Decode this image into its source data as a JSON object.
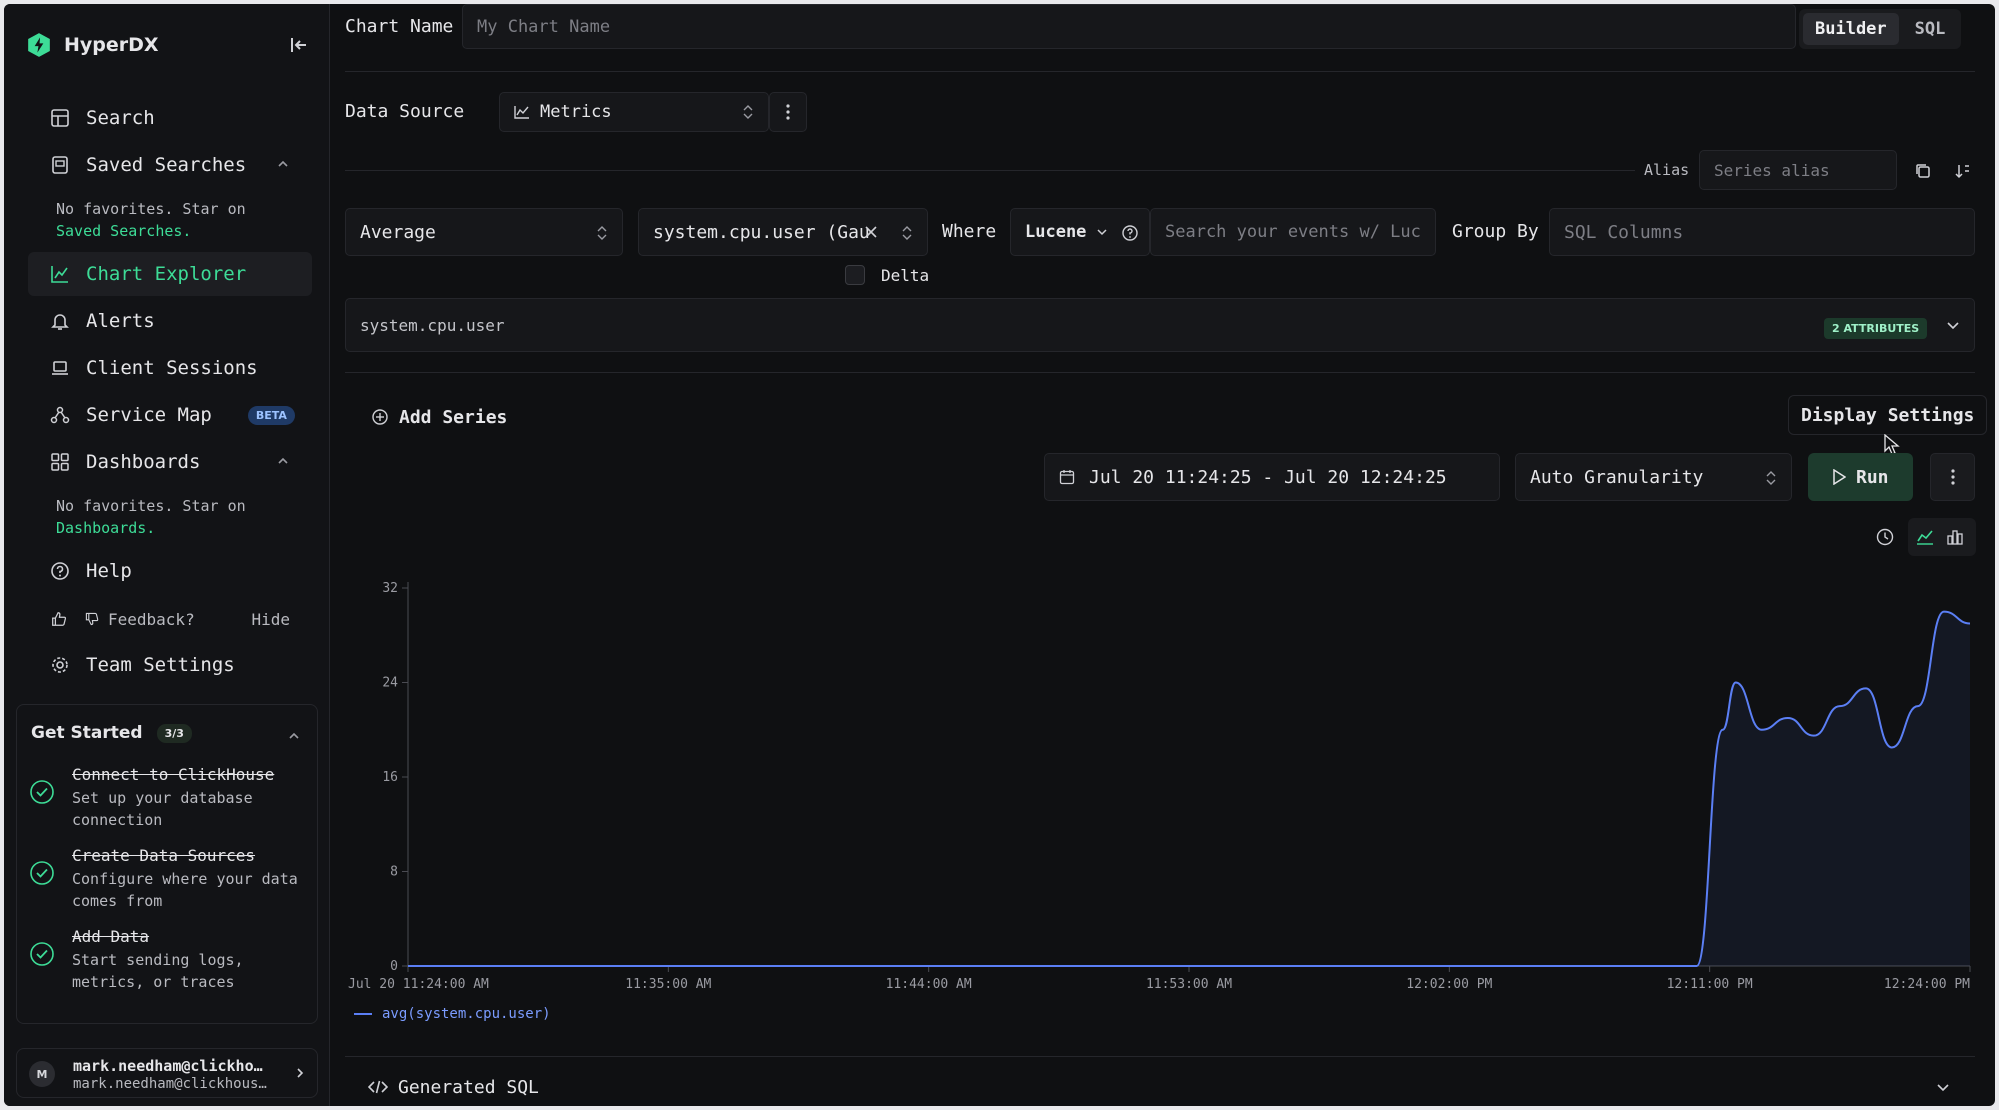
{
  "app": {
    "name": "HyperDX"
  },
  "sidebar": {
    "items": [
      {
        "label": "Search"
      },
      {
        "label": "Saved Searches"
      },
      {
        "label": "Chart Explorer"
      },
      {
        "label": "Alerts"
      },
      {
        "label": "Client Sessions"
      },
      {
        "label": "Service Map",
        "badge": "BETA"
      },
      {
        "label": "Dashboards"
      },
      {
        "label": "Help"
      },
      {
        "label": "Team Settings"
      }
    ],
    "saved_searches_note": "No favorites. Star on",
    "saved_searches_link": "Saved Searches.",
    "dashboards_note": "No favorites. Star on",
    "dashboards_link": "Dashboards.",
    "feedback_label": "Feedback?",
    "hide_label": "Hide",
    "get_started": {
      "title": "Get Started",
      "count": "3/3",
      "tasks": [
        {
          "title": "Connect to ClickHouse",
          "desc": "Set up your database connection"
        },
        {
          "title": "Create Data Sources",
          "desc": "Configure where your data comes from"
        },
        {
          "title": "Add Data",
          "desc": "Start sending logs, metrics, or traces"
        }
      ]
    },
    "user": {
      "initial": "M",
      "name": "mark.needham@clickho…",
      "email": "mark.needham@clickhous…"
    }
  },
  "header": {
    "chart_name_label": "Chart Name",
    "chart_name_placeholder": "My Chart Name",
    "mode_builder": "Builder",
    "mode_sql": "SQL"
  },
  "source": {
    "label": "Data Source",
    "value": "Metrics"
  },
  "series": {
    "alias_label": "Alias",
    "alias_placeholder": "Series alias",
    "aggregation": "Average",
    "metric": "system.cpu.user (Gau",
    "where_label": "Where",
    "query_language": "Lucene",
    "search_placeholder": "Search your events w/ Luc",
    "group_by_label": "Group By",
    "group_by_placeholder": "SQL Columns",
    "delta_label": "Delta",
    "metric_name": "system.cpu.user",
    "attributes_badge": "2 ATTRIBUTES"
  },
  "actions": {
    "add_series": "Add Series",
    "display_settings": "Display Settings",
    "time_range": "Jul 20 11:24:25 - Jul 20 12:24:25",
    "granularity": "Auto Granularity",
    "run": "Run"
  },
  "chart_data": {
    "type": "line",
    "x_tick_labels": [
      "Jul 20 11:24:00 AM",
      "11:35:00 AM",
      "11:44:00 AM",
      "11:53:00 AM",
      "12:02:00 PM",
      "12:11:00 PM",
      "12:24:00 PM"
    ],
    "y_ticks": [
      0,
      8,
      16,
      24,
      32
    ],
    "ylim": [
      0,
      32
    ],
    "series": [
      {
        "name": "avg(system.cpu.user)",
        "color": "#5b7ff5",
        "x_minutes": [
          0,
          5,
          10,
          15,
          20,
          25,
          30,
          35,
          40,
          45,
          49.5,
          50.5,
          51,
          52,
          53,
          54,
          55,
          56,
          57,
          58,
          59,
          60
        ],
        "values": [
          0,
          0,
          0,
          0,
          0,
          0,
          0,
          0,
          0,
          0,
          0,
          20,
          24,
          20,
          21,
          19.5,
          22,
          23.5,
          18.5,
          22,
          30,
          29
        ]
      }
    ]
  },
  "footer": {
    "generated_sql": "Generated SQL"
  }
}
